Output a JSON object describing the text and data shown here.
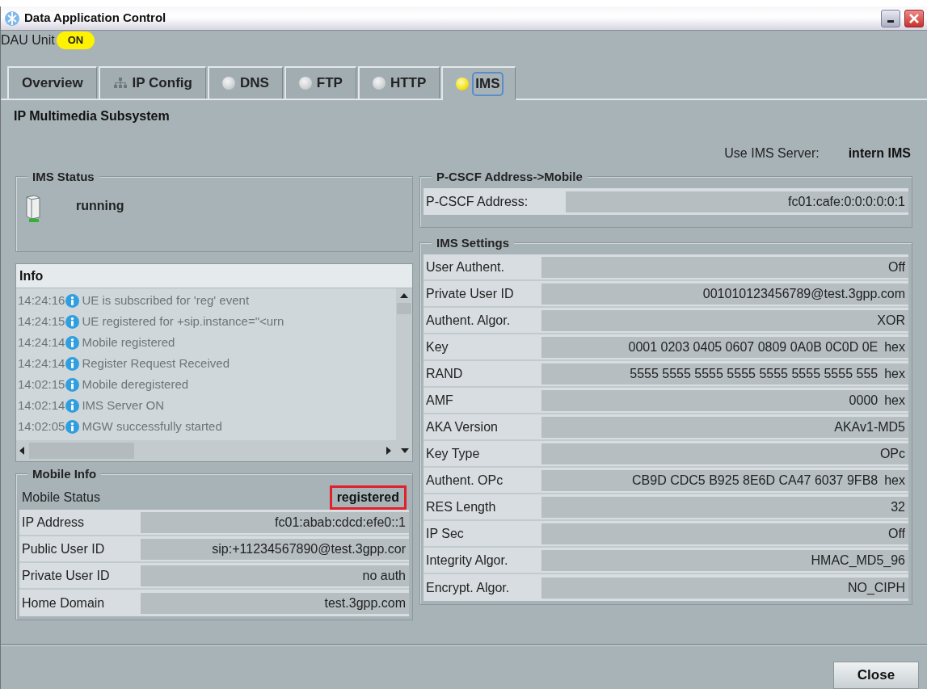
{
  "window": {
    "title": "Data Application Control"
  },
  "dau_unit": {
    "label": "DAU Unit",
    "state": "ON",
    "on": true
  },
  "tabs": [
    {
      "label": "Overview",
      "kind": "plain",
      "selected": false
    },
    {
      "label": "IP Config",
      "kind": "network",
      "selected": false
    },
    {
      "label": "DNS",
      "kind": "led",
      "lit": false,
      "selected": false
    },
    {
      "label": "FTP",
      "kind": "led",
      "lit": false,
      "selected": false
    },
    {
      "label": "HTTP",
      "kind": "led",
      "lit": false,
      "selected": false
    },
    {
      "label": "IMS",
      "kind": "led",
      "lit": true,
      "selected": true
    }
  ],
  "page_title": "IP Multimedia Subsystem",
  "ims_server": {
    "label": "Use IMS Server:",
    "value": "intern IMS"
  },
  "ims_status": {
    "title": "IMS Status",
    "status": "running"
  },
  "info": {
    "title": "Info",
    "entries": [
      {
        "time": "14:24:16",
        "message": "UE is subscribed for 'reg' event"
      },
      {
        "time": "14:24:15",
        "message": "UE registered for +sip.instance=\"<urn"
      },
      {
        "time": "14:24:14",
        "message": "Mobile registered"
      },
      {
        "time": "14:24:14",
        "message": "Register Request Received"
      },
      {
        "time": "14:02:15",
        "message": "Mobile deregistered"
      },
      {
        "time": "14:02:14",
        "message": "IMS Server ON"
      },
      {
        "time": "14:02:05",
        "message": "MGW successfully started"
      }
    ]
  },
  "mobile_info": {
    "title": "Mobile Info",
    "status_label": "Mobile Status",
    "status": "registered",
    "highlighted": true,
    "fields": [
      {
        "label": "IP Address",
        "value": "fc01:abab:cdcd:efe0::1"
      },
      {
        "label": "Public User ID",
        "value": "sip:+11234567890@test.3gpp.cor"
      },
      {
        "label": "Private User ID",
        "value": "no auth"
      },
      {
        "label": "Home Domain",
        "value": "test.3gpp.com"
      }
    ]
  },
  "pcscf": {
    "title": "P-CSCF Address->Mobile",
    "label": "P-CSCF Address:",
    "value": "fc01:cafe:0:0:0:0:0:1"
  },
  "ims_settings": {
    "title": "IMS Settings",
    "fields": [
      {
        "label": "User Authent.",
        "value": "Off"
      },
      {
        "label": "Private User ID",
        "value": "001010123456789@test.3gpp.com"
      },
      {
        "label": "Authent. Algor.",
        "value": "XOR"
      },
      {
        "label": "Key",
        "value": "0001 0203 0405 0607 0809 0A0B 0C0D 0E",
        "unit": "hex"
      },
      {
        "label": "RAND",
        "value": "5555 5555 5555 5555 5555 5555 5555 555",
        "unit": "hex"
      },
      {
        "label": "AMF",
        "value": "0000",
        "unit": "hex"
      },
      {
        "label": "AKA Version",
        "value": "AKAv1-MD5"
      },
      {
        "label": "Key Type",
        "value": "OPc"
      },
      {
        "label": "Authent. OPc",
        "value": "CB9D CDC5 B925 8E6D CA47 6037 9FB8",
        "unit": "hex"
      },
      {
        "label": "RES Length",
        "value": "32"
      },
      {
        "label": "IP Sec",
        "value": "Off"
      },
      {
        "label": "Integrity Algor.",
        "value": "HMAC_MD5_96"
      },
      {
        "label": "Encrypt. Algor.",
        "value": "NO_CIPH"
      }
    ]
  },
  "buttons": [
    {
      "label": "Close"
    }
  ]
}
